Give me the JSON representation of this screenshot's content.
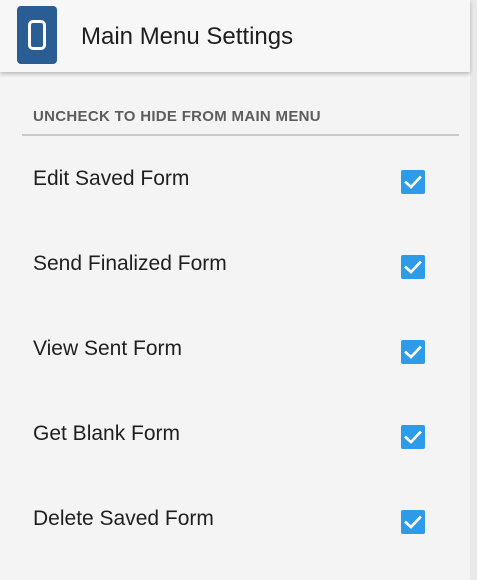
{
  "appbar": {
    "title": "Main Menu Settings",
    "icon": "app-logo-icon",
    "accent_color": "#2b5d95"
  },
  "section": {
    "header": "UNCHECK TO HIDE FROM MAIN MENU"
  },
  "menu_items": [
    {
      "label": "Edit Saved Form",
      "checked": true
    },
    {
      "label": "Send Finalized Form",
      "checked": true
    },
    {
      "label": "View Sent Form",
      "checked": true
    },
    {
      "label": "Get Blank Form",
      "checked": true
    },
    {
      "label": "Delete Saved Form",
      "checked": true
    }
  ],
  "colors": {
    "checkbox": "#2d9be8",
    "background": "#f4f4f4"
  }
}
